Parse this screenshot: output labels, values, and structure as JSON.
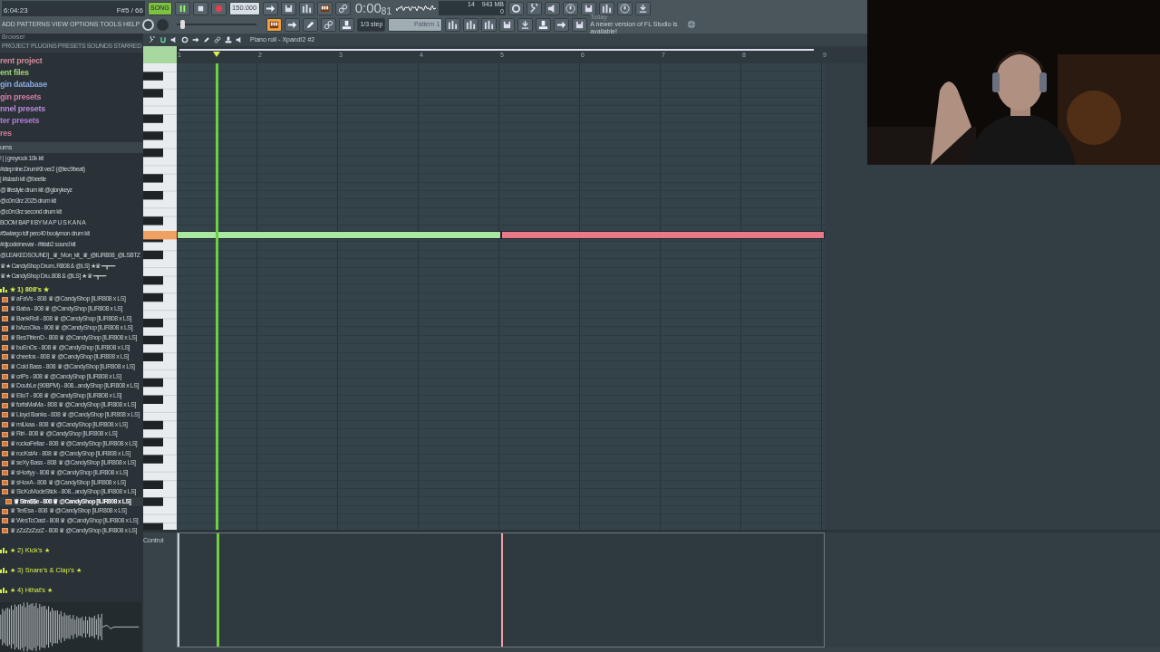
{
  "transport": {
    "time": "6:04:23",
    "info": "F#5 / 66",
    "mode": "SONG",
    "playing": true,
    "tempo": "150.000",
    "clock": "0:00",
    "clock_sub": "81",
    "memory": "14",
    "memory_mb": "943 MB",
    "voices": "0"
  },
  "menu": [
    "ADD",
    "PATTERNS",
    "VIEW",
    "OPTIONS",
    "TOOLS",
    "HELP"
  ],
  "snap": "1/3 step",
  "pattern": "Pattern 1",
  "news": {
    "when": "Today",
    "text": "A newer version of FL Studio is available!"
  },
  "browser": {
    "title": "Browser",
    "tabs": [
      "PROJECT",
      "PLUGINS",
      "PRESETS",
      "SOUNDS",
      "STARRED"
    ],
    "places": [
      {
        "label": "rent project",
        "color": "#d08a9a"
      },
      {
        "label": "ent files",
        "color": "#9fd07a"
      },
      {
        "label": "gin database",
        "color": "#8aa8e0"
      },
      {
        "label": "gin presets",
        "color": "#d27aa8"
      },
      {
        "label": "nnel presets",
        "color": "#b58ad8"
      },
      {
        "label": "ter presets",
        "color": "#b07ad0"
      },
      {
        "label": "res",
        "color": "#d27a9a"
      }
    ],
    "section": "ums",
    "kits": [
      "! | | greyrock 10k kit",
      "#stepnine.DrumKit ver2 (@tec9beat)",
      "| l#stash kit @beetle",
      "@ lifestyle drum kit @glorykeyz",
      "@c0m3rz 2025 drum kit",
      "@c0m3rz second drum kit",
      "BOOM BAP II BY M A P U S K A N A",
      "#5wlargo tdf perc40 boolymon drum kit",
      "#djcodeinewar - #trlab2 sound kit",
      "@LEAKEDSOUND] _♛_Mon_kit_♛_@ILIR808_@LSBTZ",
      "♛★ CandyShop Drum..R808 & @LS] ★♛ ━┳━━",
      "♛★ CandyShop Dru..808 & @LS] ★♛ ━┳━━"
    ],
    "folders": [
      {
        "label": "★ 1) 808's ★",
        "expanded": true,
        "children": [
          {
            "label": "♛ aFaVs - 808 ♛ @CandyShop [ILIR808 x LS]",
            "selected": false
          },
          {
            "label": "♛ Baba - 808 ♛ @CandyShop [ILIR808 x LS]",
            "selected": false
          },
          {
            "label": "♛ BankRoll - 808 ♛ @CandyShop [ILIR808 x LS]",
            "selected": false
          },
          {
            "label": "♛ bAzoOka - 808 ♛ @CandyShop [ILIR808 x LS]",
            "selected": false
          },
          {
            "label": "♛ BesTfrienD - 808 ♛ @CandyShop [ILIR808 x LS]",
            "selected": false
          },
          {
            "label": "♛ buEnOs - 808 ♛ @CandyShop [ILIR808 x LS]",
            "selected": false
          },
          {
            "label": "♛ cheetos - 808 ♛ @CandyShop [ILIR808 x LS]",
            "selected": false
          },
          {
            "label": "♛ Cold Bass - 808 ♛ @CandyShop [ILIR808 x LS]",
            "selected": false
          },
          {
            "label": "♛ criPs - 808 ♛ @CandyShop [ILIR808 x LS]",
            "selected": false
          },
          {
            "label": "♛ DoubLe (90BPM) - 808...andyShop [ILIR808 x LS]",
            "selected": false
          },
          {
            "label": "♛ ElioT - 808 ♛ @CandyShop [ILIR808 x LS]",
            "selected": false
          },
          {
            "label": "♛ forfaMaMa - 808 ♛ @CandyShop [ILIR808 x LS]",
            "selected": false
          },
          {
            "label": "♛ Lloyd Banks - 808 ♛ @CandyShop [ILIR808 x LS]",
            "selected": false
          },
          {
            "label": "♛ miLkaa - 808 ♛ @CandyShop [ILIR808 x LS]",
            "selected": false
          },
          {
            "label": "♛ Riri - 808 ♛ @CandyShop [ILIR808 x LS]",
            "selected": false
          },
          {
            "label": "♛ rockaFellaz - 808 ♛ @CandyShop [ILIR808 x LS]",
            "selected": false
          },
          {
            "label": "♛ rocKstAr - 808 ♛ @CandyShop [ILIR808 x LS]",
            "selected": false
          },
          {
            "label": "♛ seXy Bass - 808 ♛ @CandyShop [ILIR808 x LS]",
            "selected": false
          },
          {
            "label": "♛ sHortyy - 808 ♛ @CandyShop [ILIR808 x LS]",
            "selected": false
          },
          {
            "label": "♛ sHoxA - 808 ♛ @CandyShop [ILIR808 x LS]",
            "selected": false
          },
          {
            "label": "♛ SicKoModeStick - 808...andyShop [ILIR808 x LS]",
            "selected": false
          },
          {
            "label": "♛ Stra$$e - 808 ♛ @CandyShop [ILIR808 x LS]",
            "selected": true
          },
          {
            "label": "♛ TerEsa - 808 ♛ @CandyShop [ILIR808 x LS]",
            "selected": false
          },
          {
            "label": "♛ WesTcOast - 808 ♛ @CandyShop [ILIR808 x LS]",
            "selected": false
          },
          {
            "label": "♛ zZzZzZzzZ - 808 ♛ @CandyShop [ILIR808 x LS]",
            "selected": false
          }
        ]
      },
      {
        "label": "★ 2) Kick's ★",
        "expanded": false
      },
      {
        "label": "★ 3) Snare's & Clap's ★",
        "expanded": false
      },
      {
        "label": "★ 4) Hihat's ★",
        "expanded": false
      }
    ]
  },
  "piano_roll": {
    "title": "Piano roll - Xpand!2 #2",
    "bars": [
      "1",
      "2",
      "3",
      "4",
      "5",
      "6",
      "7",
      "8",
      "9"
    ],
    "notes": [
      {
        "selected": false
      },
      {
        "selected": true
      }
    ],
    "control_label": "Control"
  }
}
